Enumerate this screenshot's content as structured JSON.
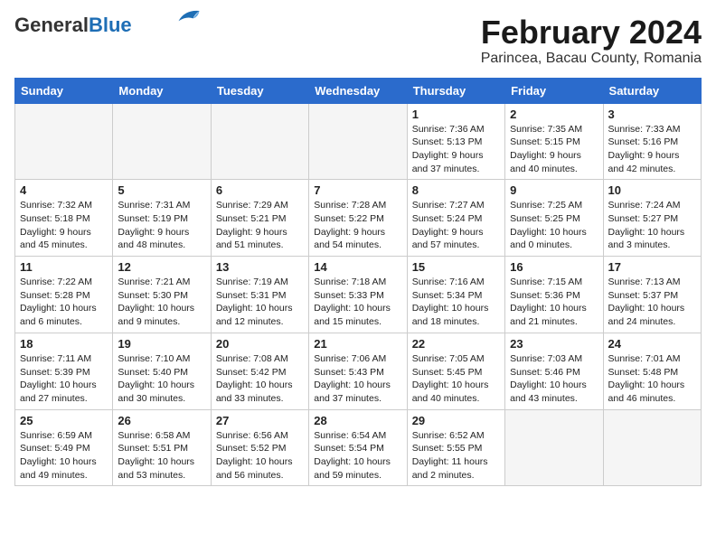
{
  "header": {
    "logo_general": "General",
    "logo_blue": "Blue",
    "title": "February 2024",
    "subtitle": "Parincea, Bacau County, Romania"
  },
  "weekdays": [
    "Sunday",
    "Monday",
    "Tuesday",
    "Wednesday",
    "Thursday",
    "Friday",
    "Saturday"
  ],
  "weeks": [
    [
      {
        "day": "",
        "info": ""
      },
      {
        "day": "",
        "info": ""
      },
      {
        "day": "",
        "info": ""
      },
      {
        "day": "",
        "info": ""
      },
      {
        "day": "1",
        "info": "Sunrise: 7:36 AM\nSunset: 5:13 PM\nDaylight: 9 hours\nand 37 minutes."
      },
      {
        "day": "2",
        "info": "Sunrise: 7:35 AM\nSunset: 5:15 PM\nDaylight: 9 hours\nand 40 minutes."
      },
      {
        "day": "3",
        "info": "Sunrise: 7:33 AM\nSunset: 5:16 PM\nDaylight: 9 hours\nand 42 minutes."
      }
    ],
    [
      {
        "day": "4",
        "info": "Sunrise: 7:32 AM\nSunset: 5:18 PM\nDaylight: 9 hours\nand 45 minutes."
      },
      {
        "day": "5",
        "info": "Sunrise: 7:31 AM\nSunset: 5:19 PM\nDaylight: 9 hours\nand 48 minutes."
      },
      {
        "day": "6",
        "info": "Sunrise: 7:29 AM\nSunset: 5:21 PM\nDaylight: 9 hours\nand 51 minutes."
      },
      {
        "day": "7",
        "info": "Sunrise: 7:28 AM\nSunset: 5:22 PM\nDaylight: 9 hours\nand 54 minutes."
      },
      {
        "day": "8",
        "info": "Sunrise: 7:27 AM\nSunset: 5:24 PM\nDaylight: 9 hours\nand 57 minutes."
      },
      {
        "day": "9",
        "info": "Sunrise: 7:25 AM\nSunset: 5:25 PM\nDaylight: 10 hours\nand 0 minutes."
      },
      {
        "day": "10",
        "info": "Sunrise: 7:24 AM\nSunset: 5:27 PM\nDaylight: 10 hours\nand 3 minutes."
      }
    ],
    [
      {
        "day": "11",
        "info": "Sunrise: 7:22 AM\nSunset: 5:28 PM\nDaylight: 10 hours\nand 6 minutes."
      },
      {
        "day": "12",
        "info": "Sunrise: 7:21 AM\nSunset: 5:30 PM\nDaylight: 10 hours\nand 9 minutes."
      },
      {
        "day": "13",
        "info": "Sunrise: 7:19 AM\nSunset: 5:31 PM\nDaylight: 10 hours\nand 12 minutes."
      },
      {
        "day": "14",
        "info": "Sunrise: 7:18 AM\nSunset: 5:33 PM\nDaylight: 10 hours\nand 15 minutes."
      },
      {
        "day": "15",
        "info": "Sunrise: 7:16 AM\nSunset: 5:34 PM\nDaylight: 10 hours\nand 18 minutes."
      },
      {
        "day": "16",
        "info": "Sunrise: 7:15 AM\nSunset: 5:36 PM\nDaylight: 10 hours\nand 21 minutes."
      },
      {
        "day": "17",
        "info": "Sunrise: 7:13 AM\nSunset: 5:37 PM\nDaylight: 10 hours\nand 24 minutes."
      }
    ],
    [
      {
        "day": "18",
        "info": "Sunrise: 7:11 AM\nSunset: 5:39 PM\nDaylight: 10 hours\nand 27 minutes."
      },
      {
        "day": "19",
        "info": "Sunrise: 7:10 AM\nSunset: 5:40 PM\nDaylight: 10 hours\nand 30 minutes."
      },
      {
        "day": "20",
        "info": "Sunrise: 7:08 AM\nSunset: 5:42 PM\nDaylight: 10 hours\nand 33 minutes."
      },
      {
        "day": "21",
        "info": "Sunrise: 7:06 AM\nSunset: 5:43 PM\nDaylight: 10 hours\nand 37 minutes."
      },
      {
        "day": "22",
        "info": "Sunrise: 7:05 AM\nSunset: 5:45 PM\nDaylight: 10 hours\nand 40 minutes."
      },
      {
        "day": "23",
        "info": "Sunrise: 7:03 AM\nSunset: 5:46 PM\nDaylight: 10 hours\nand 43 minutes."
      },
      {
        "day": "24",
        "info": "Sunrise: 7:01 AM\nSunset: 5:48 PM\nDaylight: 10 hours\nand 46 minutes."
      }
    ],
    [
      {
        "day": "25",
        "info": "Sunrise: 6:59 AM\nSunset: 5:49 PM\nDaylight: 10 hours\nand 49 minutes."
      },
      {
        "day": "26",
        "info": "Sunrise: 6:58 AM\nSunset: 5:51 PM\nDaylight: 10 hours\nand 53 minutes."
      },
      {
        "day": "27",
        "info": "Sunrise: 6:56 AM\nSunset: 5:52 PM\nDaylight: 10 hours\nand 56 minutes."
      },
      {
        "day": "28",
        "info": "Sunrise: 6:54 AM\nSunset: 5:54 PM\nDaylight: 10 hours\nand 59 minutes."
      },
      {
        "day": "29",
        "info": "Sunrise: 6:52 AM\nSunset: 5:55 PM\nDaylight: 11 hours\nand 2 minutes."
      },
      {
        "day": "",
        "info": ""
      },
      {
        "day": "",
        "info": ""
      }
    ]
  ]
}
